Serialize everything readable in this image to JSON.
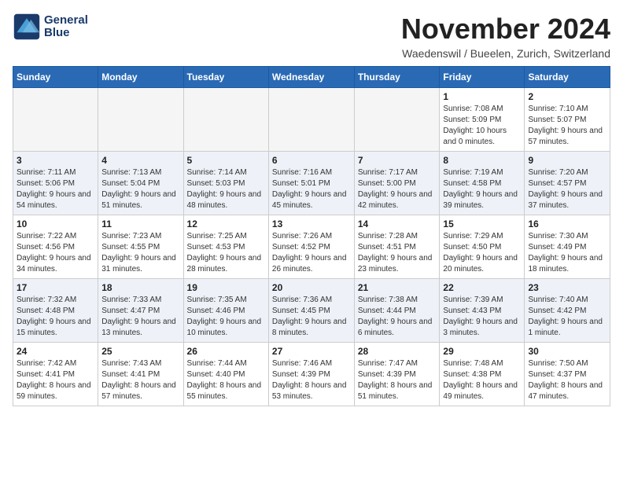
{
  "header": {
    "logo_line1": "General",
    "logo_line2": "Blue",
    "month": "November 2024",
    "location": "Waedenswil / Bueelen, Zurich, Switzerland"
  },
  "weekdays": [
    "Sunday",
    "Monday",
    "Tuesday",
    "Wednesday",
    "Thursday",
    "Friday",
    "Saturday"
  ],
  "weeks": [
    [
      {
        "day": "",
        "info": ""
      },
      {
        "day": "",
        "info": ""
      },
      {
        "day": "",
        "info": ""
      },
      {
        "day": "",
        "info": ""
      },
      {
        "day": "",
        "info": ""
      },
      {
        "day": "1",
        "info": "Sunrise: 7:08 AM\nSunset: 5:09 PM\nDaylight: 10 hours and 0 minutes."
      },
      {
        "day": "2",
        "info": "Sunrise: 7:10 AM\nSunset: 5:07 PM\nDaylight: 9 hours and 57 minutes."
      }
    ],
    [
      {
        "day": "3",
        "info": "Sunrise: 7:11 AM\nSunset: 5:06 PM\nDaylight: 9 hours and 54 minutes."
      },
      {
        "day": "4",
        "info": "Sunrise: 7:13 AM\nSunset: 5:04 PM\nDaylight: 9 hours and 51 minutes."
      },
      {
        "day": "5",
        "info": "Sunrise: 7:14 AM\nSunset: 5:03 PM\nDaylight: 9 hours and 48 minutes."
      },
      {
        "day": "6",
        "info": "Sunrise: 7:16 AM\nSunset: 5:01 PM\nDaylight: 9 hours and 45 minutes."
      },
      {
        "day": "7",
        "info": "Sunrise: 7:17 AM\nSunset: 5:00 PM\nDaylight: 9 hours and 42 minutes."
      },
      {
        "day": "8",
        "info": "Sunrise: 7:19 AM\nSunset: 4:58 PM\nDaylight: 9 hours and 39 minutes."
      },
      {
        "day": "9",
        "info": "Sunrise: 7:20 AM\nSunset: 4:57 PM\nDaylight: 9 hours and 37 minutes."
      }
    ],
    [
      {
        "day": "10",
        "info": "Sunrise: 7:22 AM\nSunset: 4:56 PM\nDaylight: 9 hours and 34 minutes."
      },
      {
        "day": "11",
        "info": "Sunrise: 7:23 AM\nSunset: 4:55 PM\nDaylight: 9 hours and 31 minutes."
      },
      {
        "day": "12",
        "info": "Sunrise: 7:25 AM\nSunset: 4:53 PM\nDaylight: 9 hours and 28 minutes."
      },
      {
        "day": "13",
        "info": "Sunrise: 7:26 AM\nSunset: 4:52 PM\nDaylight: 9 hours and 26 minutes."
      },
      {
        "day": "14",
        "info": "Sunrise: 7:28 AM\nSunset: 4:51 PM\nDaylight: 9 hours and 23 minutes."
      },
      {
        "day": "15",
        "info": "Sunrise: 7:29 AM\nSunset: 4:50 PM\nDaylight: 9 hours and 20 minutes."
      },
      {
        "day": "16",
        "info": "Sunrise: 7:30 AM\nSunset: 4:49 PM\nDaylight: 9 hours and 18 minutes."
      }
    ],
    [
      {
        "day": "17",
        "info": "Sunrise: 7:32 AM\nSunset: 4:48 PM\nDaylight: 9 hours and 15 minutes."
      },
      {
        "day": "18",
        "info": "Sunrise: 7:33 AM\nSunset: 4:47 PM\nDaylight: 9 hours and 13 minutes."
      },
      {
        "day": "19",
        "info": "Sunrise: 7:35 AM\nSunset: 4:46 PM\nDaylight: 9 hours and 10 minutes."
      },
      {
        "day": "20",
        "info": "Sunrise: 7:36 AM\nSunset: 4:45 PM\nDaylight: 9 hours and 8 minutes."
      },
      {
        "day": "21",
        "info": "Sunrise: 7:38 AM\nSunset: 4:44 PM\nDaylight: 9 hours and 6 minutes."
      },
      {
        "day": "22",
        "info": "Sunrise: 7:39 AM\nSunset: 4:43 PM\nDaylight: 9 hours and 3 minutes."
      },
      {
        "day": "23",
        "info": "Sunrise: 7:40 AM\nSunset: 4:42 PM\nDaylight: 9 hours and 1 minute."
      }
    ],
    [
      {
        "day": "24",
        "info": "Sunrise: 7:42 AM\nSunset: 4:41 PM\nDaylight: 8 hours and 59 minutes."
      },
      {
        "day": "25",
        "info": "Sunrise: 7:43 AM\nSunset: 4:41 PM\nDaylight: 8 hours and 57 minutes."
      },
      {
        "day": "26",
        "info": "Sunrise: 7:44 AM\nSunset: 4:40 PM\nDaylight: 8 hours and 55 minutes."
      },
      {
        "day": "27",
        "info": "Sunrise: 7:46 AM\nSunset: 4:39 PM\nDaylight: 8 hours and 53 minutes."
      },
      {
        "day": "28",
        "info": "Sunrise: 7:47 AM\nSunset: 4:39 PM\nDaylight: 8 hours and 51 minutes."
      },
      {
        "day": "29",
        "info": "Sunrise: 7:48 AM\nSunset: 4:38 PM\nDaylight: 8 hours and 49 minutes."
      },
      {
        "day": "30",
        "info": "Sunrise: 7:50 AM\nSunset: 4:37 PM\nDaylight: 8 hours and 47 minutes."
      }
    ]
  ]
}
